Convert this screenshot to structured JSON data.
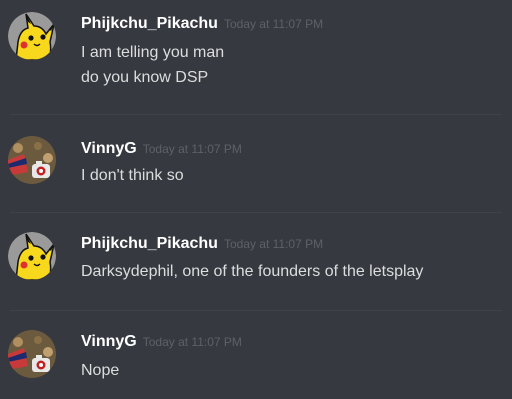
{
  "messages": [
    {
      "author": "Phijkchu_Pikachu",
      "avatar": "pikachu-avatar-icon",
      "timestamp": "Today at 11:07 PM",
      "lines": [
        "I am telling you man",
        "do you know DSP"
      ]
    },
    {
      "author": "VinnyG",
      "avatar": "vinnyg-avatar-icon",
      "timestamp": "Today at 11:07 PM",
      "lines": [
        "I don't think so"
      ]
    },
    {
      "author": "Phijkchu_Pikachu",
      "avatar": "pikachu-avatar-icon",
      "timestamp": "Today at 11:07 PM",
      "lines": [
        "Darksydephil, one of the founders of the letsplay"
      ]
    },
    {
      "author": "VinnyG",
      "avatar": "vinnyg-avatar-icon",
      "timestamp": "Today at 11:07 PM",
      "lines": [
        "Nope"
      ]
    }
  ],
  "colors": {
    "background": "#36393f",
    "username": "#ffffff",
    "message_text": "#dcddde",
    "timestamp": "#5e6166",
    "divider": "#3f4248",
    "pikachu_yellow": "#f8d81c"
  }
}
